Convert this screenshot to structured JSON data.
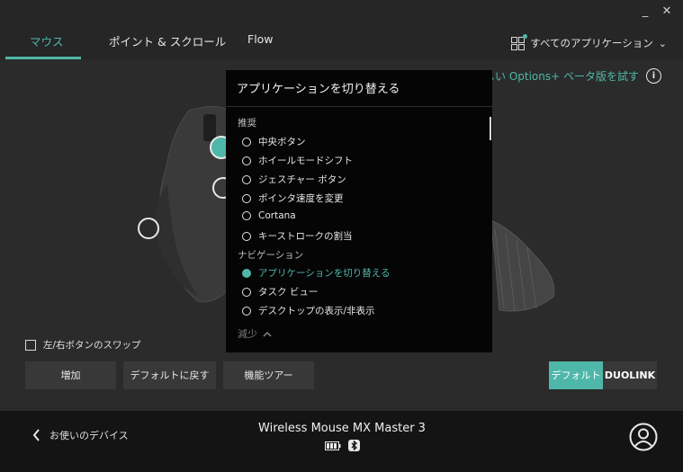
{
  "window": {
    "minimize": "_",
    "close": "✕"
  },
  "tabs": [
    {
      "label": "マウス",
      "active": true
    },
    {
      "label": "ポイント & スクロール",
      "active": false
    },
    {
      "label": "Flow",
      "active": false
    }
  ],
  "apps_selector": {
    "label": "すべてのアプリケーション",
    "icon": "apps-grid-icon",
    "chevron": "⌄"
  },
  "beta_banner": {
    "text": "新しい Options+ ベータ版を試す",
    "info": "i"
  },
  "swap_buttons": {
    "label": "左/右ボタンのスワップ",
    "checked": false
  },
  "buttons": {
    "add": "増加",
    "restore_default": "デフォルトに戻す",
    "feature_tour": "機能ツアー",
    "default": "デフォルト",
    "duolink": "DUOLINK"
  },
  "footer": {
    "back_label": "お使いのデバイス",
    "device_name": "Wireless Mouse MX Master 3"
  },
  "popup": {
    "title": "アプリケーションを切り替える",
    "sections": [
      {
        "heading": "推奨",
        "items": [
          {
            "label": "中央ボタン",
            "selected": false
          },
          {
            "label": "ホイールモードシフト",
            "selected": false
          },
          {
            "label": "ジェスチャー ボタン",
            "selected": false
          },
          {
            "label": "ポインタ速度を変更",
            "selected": false
          },
          {
            "label": "Cortana",
            "selected": false
          },
          {
            "label": "キーストロークの割当",
            "selected": false
          }
        ]
      },
      {
        "heading": "ナビゲーション",
        "items": [
          {
            "label": "アプリケーションを切り替える",
            "selected": true
          },
          {
            "label": "タスク ビュー",
            "selected": false
          },
          {
            "label": "デスクトップの表示/非表示",
            "selected": false
          }
        ]
      }
    ],
    "less_label": "減少"
  },
  "colors": {
    "accent": "#4fb7a9",
    "background": "#2b2b2b",
    "footer": "#141414",
    "popup": "#050505"
  }
}
